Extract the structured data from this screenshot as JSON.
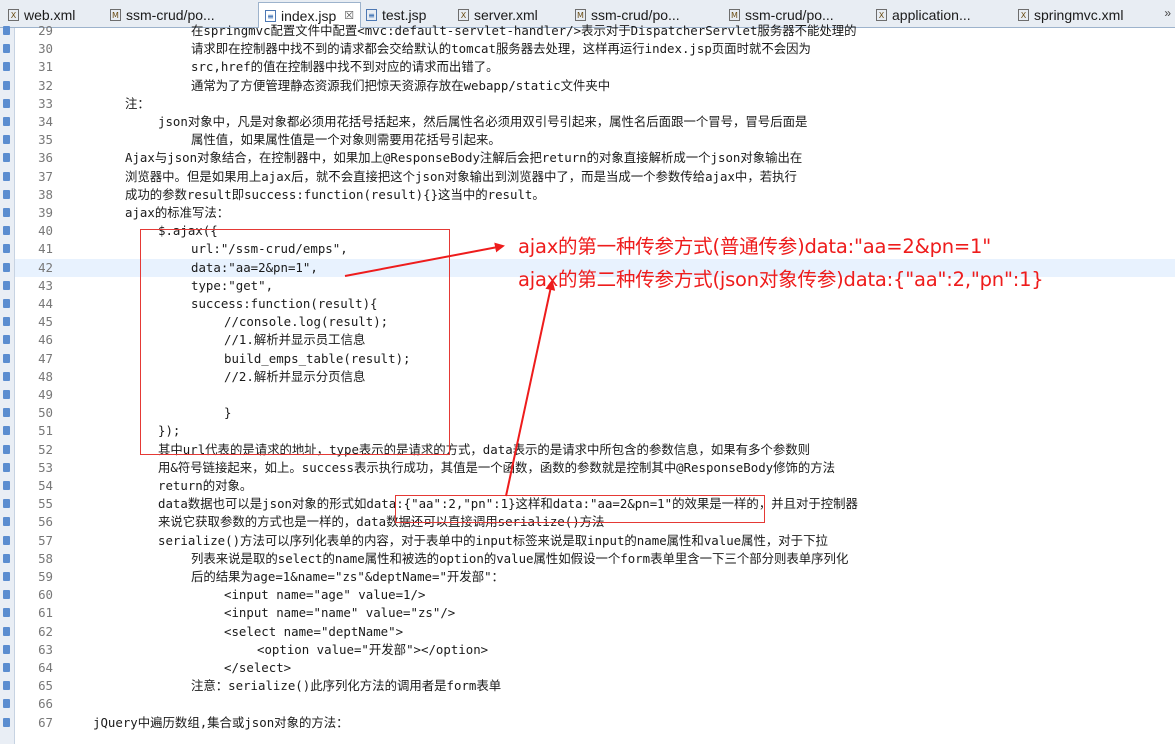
{
  "tabs": [
    {
      "label": "web.xml",
      "icon": "xml-file-icon",
      "active": false
    },
    {
      "label": "ssm-crud/po...",
      "icon": "maven-pom-icon",
      "active": false
    },
    {
      "label": "index.jsp",
      "icon": "jsp-file-icon",
      "active": true,
      "close": "☒"
    },
    {
      "label": "test.jsp",
      "icon": "jsp-file-icon",
      "active": false
    },
    {
      "label": "server.xml",
      "icon": "xml-file-icon",
      "active": false
    },
    {
      "label": "ssm-crud/po...",
      "icon": "maven-pom-icon",
      "active": false
    },
    {
      "label": "ssm-crud/po...",
      "icon": "maven-pom-icon",
      "active": false
    },
    {
      "label": "application...",
      "icon": "xml-file-icon",
      "active": false
    },
    {
      "label": "springmvc.xml",
      "icon": "xml-file-icon",
      "active": false
    }
  ],
  "overflow": "»",
  "lines": [
    {
      "n": "29",
      "t": "在springmvc配置文件中配置<mvc:default-servlet-handler/>表示对于DispatcherServlet服务器不能处理的"
    },
    {
      "n": "30",
      "t": "请求即在控制器中找不到的请求都会交给默认的tomcat服务器去处理，这样再运行index.jsp页面时就不会因为"
    },
    {
      "n": "31",
      "t": "src,href的值在控制器中找不到对应的请求而出错了。"
    },
    {
      "n": "32",
      "t": "通常为了方便管理静态资源我们把惊天资源存放在webapp/static文件夹中"
    },
    {
      "n": "33",
      "t": "注："
    },
    {
      "n": "34",
      "t": "json对象中，凡是对象都必须用花括号括起来，然后属性名必须用双引号引起来，属性名后面跟一个冒号，冒号后面是"
    },
    {
      "n": "35",
      "t": "属性值，如果属性值是一个对象则需要用花括号引起来。"
    },
    {
      "n": "36",
      "t": "Ajax与json对象结合，在控制器中，如果加上@ResponseBody注解后会把return的对象直接解析成一个json对象输出在"
    },
    {
      "n": "37",
      "t": "浏览器中。但是如果用上ajax后，就不会直接把这个json对象输出到浏览器中了，而是当成一个参数传给ajax中，若执行"
    },
    {
      "n": "38",
      "t": "成功的参数result即success:function(result){}这当中的result。"
    },
    {
      "n": "39",
      "t": "ajax的标准写法："
    },
    {
      "n": "40",
      "t": "$.ajax({"
    },
    {
      "n": "41",
      "t": "url:\"/ssm-crud/emps\","
    },
    {
      "n": "42",
      "t": "data:\"aa=2&pn=1\","
    },
    {
      "n": "43",
      "t": "type:\"get\","
    },
    {
      "n": "44",
      "t": "success:function(result){"
    },
    {
      "n": "45",
      "t": "//console.log(result);"
    },
    {
      "n": "46",
      "t": "//1.解析并显示员工信息"
    },
    {
      "n": "47",
      "t": "build_emps_table(result);"
    },
    {
      "n": "48",
      "t": "//2.解析并显示分页信息"
    },
    {
      "n": "49",
      "t": ""
    },
    {
      "n": "50",
      "t": "}"
    },
    {
      "n": "51",
      "t": "});"
    },
    {
      "n": "52",
      "t": "其中url代表的是请求的地址，type表示的是请求的方式，data表示的是请求中所包含的参数信息，如果有多个参数则"
    },
    {
      "n": "53",
      "t": "用&符号链接起来，如上。success表示执行成功，其值是一个函数，函数的参数就是控制其中@ResponseBody修饰的方法"
    },
    {
      "n": "54",
      "t": "return的对象。"
    },
    {
      "n": "55",
      "t": "data数据也可以是json对象的形式如data:{\"aa\":2,\"pn\":1}这样和data:\"aa=2&pn=1\"的效果是一样的，并且对于控制器"
    },
    {
      "n": "56",
      "t": "来说它获取参数的方式也是一样的，data数据还可以直接调用serialize()方法"
    },
    {
      "n": "57",
      "t": "serialize()方法可以序列化表单的内容，对于表单中的input标签来说是取input的name属性和value属性，对于下拉"
    },
    {
      "n": "58",
      "t": "列表来说是取的select的name属性和被选的option的value属性如假设一个form表单里含一下三个部分则表单序列化"
    },
    {
      "n": "59",
      "t": "后的结果为age=1&name=\"zs\"&deptName=\"开发部\"："
    },
    {
      "n": "60",
      "t": "<input name=\"age\" value=1/>"
    },
    {
      "n": "61",
      "t": "<input name=\"name\" value=\"zs\"/>"
    },
    {
      "n": "62",
      "t": "<select name=\"deptName\">"
    },
    {
      "n": "63",
      "t": "<option value=\"开发部\"></option>"
    },
    {
      "n": "64",
      "t": "</select>"
    },
    {
      "n": "65",
      "t": "注意：serialize()此序列化方法的调用者是form表单"
    },
    {
      "n": "66",
      "t": ""
    },
    {
      "n": "67",
      "t": "jQuery中遍历数组,集合或json对象的方法："
    }
  ],
  "annotations": {
    "first": "ajax的第一种传参方式(普通传参)data:\"aa=2&pn=1\"",
    "second": "ajax的第二种传参方式(json对象传参)data:{\"aa\":2,\"pn\":1}"
  },
  "colors": {
    "annotation_red": "#ee1c1c",
    "line_number": "#787878",
    "current_line_bg": "#e8f2fe",
    "tab_bar_bg": "#e8edf3"
  }
}
